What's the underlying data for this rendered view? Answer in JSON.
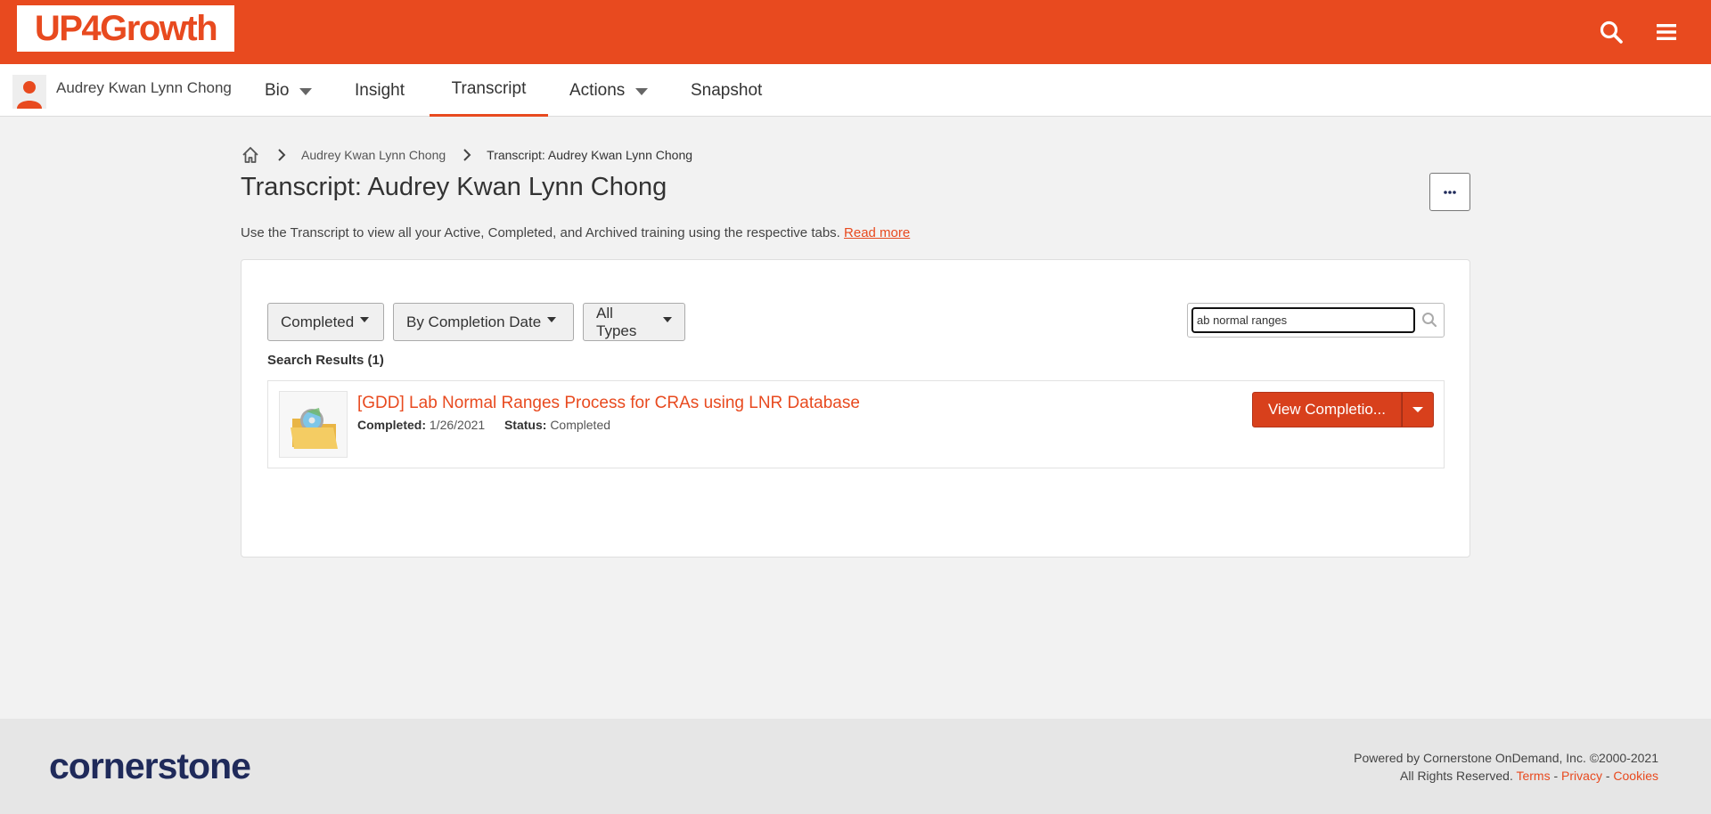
{
  "brand": {
    "logo_text": "UP4Growth",
    "color": "#e84a1f"
  },
  "header": {
    "search_icon": "search-icon",
    "menu_icon": "hamburger-menu-icon"
  },
  "profile": {
    "name": "Audrey Kwan Lynn Chong",
    "avatar_icon": "user-avatar-icon"
  },
  "nav": {
    "bio": "Bio",
    "insight": "Insight",
    "transcript": "Transcript",
    "actions": "Actions",
    "snapshot": "Snapshot",
    "active": "Transcript"
  },
  "breadcrumb": {
    "home_icon": "home-icon",
    "items": [
      "Audrey Kwan Lynn Chong",
      "Transcript: Audrey Kwan Lynn Chong"
    ]
  },
  "page": {
    "title": "Transcript: Audrey Kwan Lynn Chong",
    "more_label": "···",
    "intro": "Use the Transcript to view all your Active, Completed, and Archived training using the respective tabs. ",
    "read_more": "Read more"
  },
  "filters": {
    "status": "Completed",
    "sort": "By Completion Date",
    "type": "All Types"
  },
  "search": {
    "value": "ab normal ranges",
    "icon": "search-icon"
  },
  "results": {
    "label": "Search Results (1)",
    "items": [
      {
        "title": "[GDD] Lab Normal Ranges Process for CRAs using LNR Database",
        "completed_label": "Completed:",
        "completed_date": "1/26/2021",
        "status_label": "Status:",
        "status": "Completed",
        "action": "View Completio...",
        "icon": "course-folder-icon"
      }
    ]
  },
  "footer": {
    "logo_text": "cornerstone",
    "powered": "Powered by Cornerstone OnDemand, Inc. ©2000-2021",
    "rights": "All Rights Reserved.",
    "terms": "Terms",
    "privacy": "Privacy",
    "cookies": "Cookies",
    "separator": " - "
  }
}
